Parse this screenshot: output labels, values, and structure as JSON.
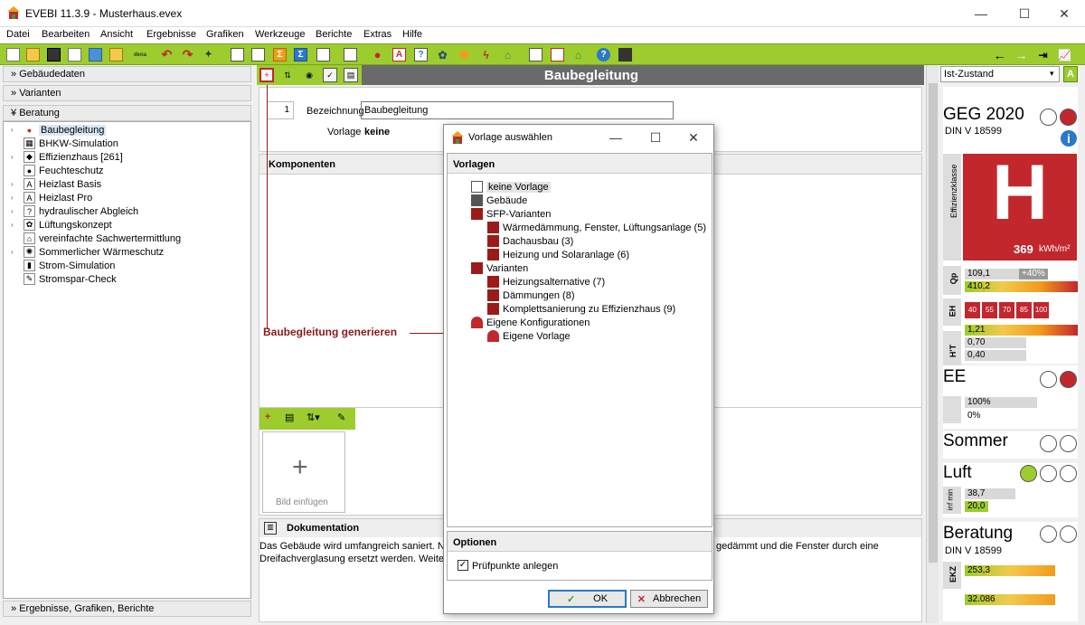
{
  "window": {
    "title": "EVEBI 11.3.9 - Musterhaus.evex",
    "minimize": "—",
    "maximize": "☐",
    "close": "✕"
  },
  "menu": [
    "Datei",
    "Bearbeiten",
    "Ansicht",
    "Ergebnisse",
    "Grafiken",
    "Werkzeuge",
    "Berichte",
    "Extras",
    "Hilfe"
  ],
  "left": {
    "sections": {
      "gebaeudedaten": "Gebäudedaten",
      "varianten": "Varianten",
      "beratung": "Beratung",
      "ergebnisse": "Ergebnisse, Grafiken, Berichte"
    },
    "tree": [
      {
        "label": "Baubegleitung",
        "icon": "●",
        "arrow": "›"
      },
      {
        "label": "BHKW-Simulation",
        "icon": "▦",
        "arrow": ""
      },
      {
        "label": "Effizienzhaus [261]",
        "icon": "◆",
        "arrow": "›"
      },
      {
        "label": "Feuchteschutz",
        "icon": "●",
        "arrow": ""
      },
      {
        "label": "Heizlast Basis",
        "icon": "A",
        "arrow": "›"
      },
      {
        "label": "Heizlast Pro",
        "icon": "A",
        "arrow": "›"
      },
      {
        "label": "hydraulischer Abgleich",
        "icon": "?",
        "arrow": "›"
      },
      {
        "label": "Lüftungskonzept",
        "icon": "✿",
        "arrow": "›"
      },
      {
        "label": "vereinfachte Sachwertermittlung",
        "icon": "⌂",
        "arrow": ""
      },
      {
        "label": "Sommerlicher Wärmeschutz",
        "icon": "✺",
        "arrow": "›"
      },
      {
        "label": "Strom-Simulation",
        "icon": "▮",
        "arrow": ""
      },
      {
        "label": "Stromspar-Check",
        "icon": "✎",
        "arrow": ""
      }
    ]
  },
  "center": {
    "title": "Baubegleitung",
    "number": "1",
    "bezeichnung_label": "Bezeichnung",
    "bezeichnung_value": "Baubegleitung",
    "vorlage_label": "Vorlage",
    "vorlage_value": "keine",
    "komponenten": "Komponenten",
    "annotation": "Baubegleitung generieren",
    "bild_einfuegen": "Bild einfügen",
    "plus": "+",
    "dokumentation": "Dokumentation",
    "doc_line1_left": "Das Gebäude wird umfangreich saniert. Nebe",
    "doc_line1_right": "gedämmt und die Fenster durch eine",
    "doc_line2_left": "Dreifachverglasung ersetzt werden. Weiterhi"
  },
  "dialog": {
    "title": "Vorlage auswählen",
    "vorlagen": "Vorlagen",
    "optionen": "Optionen",
    "checkbox_label": "Prüfpunkte anlegen",
    "ok": "OK",
    "abbrechen": "Abbrechen",
    "tree": [
      {
        "label": "keine Vorlage",
        "indent": 1
      },
      {
        "label": "Gebäude",
        "indent": 1
      },
      {
        "label": "SFP-Varianten",
        "indent": 1
      },
      {
        "label": "Wärmedämmung, Fenster, Lüftungsanlage (5)",
        "indent": 2
      },
      {
        "label": "Dachausbau (3)",
        "indent": 2
      },
      {
        "label": "Heizung und Solaranlage (6)",
        "indent": 2
      },
      {
        "label": "Varianten",
        "indent": 1
      },
      {
        "label": "Heizungsalternative (7)",
        "indent": 2
      },
      {
        "label": "Dämmungen (8)",
        "indent": 2
      },
      {
        "label": "Komplettsanierung zu Effizienzhaus (9)",
        "indent": 2
      },
      {
        "label": "Eigene Konfigurationen",
        "indent": 1
      },
      {
        "label": "Eigene Vorlage",
        "indent": 2
      }
    ]
  },
  "right": {
    "state_select": "Ist-Zustand",
    "a_button": "A",
    "geg": "GEG 2020",
    "din": "DIN V 18599",
    "effizienzklasse": "Effizienzklasse",
    "class_letter": "H",
    "class_value": "369",
    "class_unit": "kWh/m²",
    "qp_label": "Qp",
    "qp1": "109,1",
    "qp_pct": "+40%",
    "qp2": "410,2",
    "eh_label": "EH",
    "eh_values": [
      "40",
      "55",
      "70",
      "85",
      "100"
    ],
    "ht_label": "H'T",
    "ht1": "1,21",
    "ht2": "0,70",
    "ht3": "0,40",
    "ee": "EE",
    "ee1": "100%",
    "ee2": "0%",
    "sommer": "Sommer",
    "luft": "Luft",
    "luft_label": "inf min",
    "luft1": "38,7",
    "luft2": "20,0",
    "beratung": "Beratung",
    "din2": "DIN V 18599",
    "ekz_label": "EKZ",
    "ekz1": "253,3",
    "ekz2": "32.086",
    "info": "i"
  },
  "colors": {
    "accent": "#9ccc2e",
    "red": "#c1272d",
    "header": "#6a6a6a"
  }
}
